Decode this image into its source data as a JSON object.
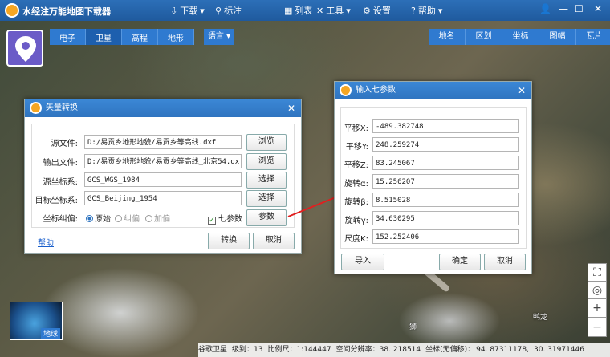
{
  "app": {
    "title": "水经注万能地图下载器"
  },
  "topmenu": {
    "download": "下载",
    "mark": "标注",
    "list": "列表",
    "tools": "工具",
    "settings": "设置",
    "help": "帮助"
  },
  "maptabs": [
    "电子",
    "卫星",
    "高程",
    "地形"
  ],
  "lang": "语言",
  "righttabs": [
    "地名",
    "区划",
    "坐标",
    "图幅",
    "瓦片"
  ],
  "minimap_label": "地球",
  "map_labels": {
    "place1": "鸭龙",
    "place2": "狮"
  },
  "statusbar": {
    "source": "谷歌卫星",
    "level": "级别：13",
    "scale": "比例尺：1:144447",
    "resolution": "空间分辨率：38. 218514",
    "coord_type": "坐标(无偏移)：",
    "lng": "94. 87311178,",
    "lat": "30. 31971446"
  },
  "vector_dialog": {
    "title": "矢量转换",
    "src_file_label": "源文件:",
    "src_file_value": "D:/易贡乡地形地貌/易贡乡等高线.dxf",
    "out_file_label": "输出文件:",
    "out_file_value": "D:/易贡乡地形地貌/易贡乡等高线_北京54.dxf",
    "src_crs_label": "源坐标系:",
    "src_crs_value": "GCS_WGS_1984",
    "dst_crs_label": "目标坐标系:",
    "dst_crs_value": "GCS_Beijing_1954",
    "offset_label": "坐标纠偏:",
    "radio_original": "原始",
    "radio_correct": "纠偏",
    "radio_offset": "加偏",
    "seven_param_label": "七参数",
    "browse1": "浏览",
    "browse2": "浏览",
    "select1": "选择",
    "select2": "选择",
    "params_button": "参数",
    "help_link": "帮助",
    "convert_button": "转换",
    "cancel_button": "取消"
  },
  "seven_dialog": {
    "title": "输入七参数",
    "params": [
      {
        "label": "平移X:",
        "value": "-489.382748"
      },
      {
        "label": "平移Y:",
        "value": "248.259274"
      },
      {
        "label": "平移Z:",
        "value": "83.245067"
      },
      {
        "label": "旋转α:",
        "value": "15.256207"
      },
      {
        "label": "旋转β:",
        "value": "8.515028"
      },
      {
        "label": "旋转γ:",
        "value": "34.630295"
      },
      {
        "label": "尺度K:",
        "value": "152.252406"
      }
    ],
    "import_button": "导入",
    "ok_button": "确定",
    "cancel_button": "取消"
  }
}
